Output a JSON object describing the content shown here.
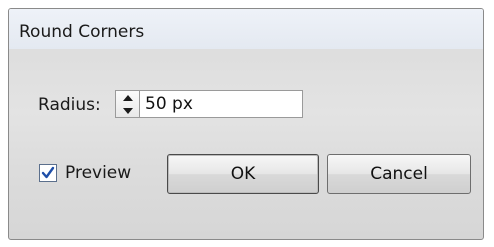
{
  "dialog": {
    "title": "Round Corners",
    "radius_label": "Radius:",
    "radius_value": "50 px",
    "preview_label": "Preview",
    "preview_checked": true,
    "ok_label": "OK",
    "cancel_label": "Cancel"
  },
  "icons": {
    "spin_up": "triangle-up-icon",
    "spin_down": "triangle-down-icon",
    "checkmark": "checkmark-icon"
  },
  "colors": {
    "checkmark": "#1f4fa8",
    "checkbox_border": "#5b6f8c"
  }
}
